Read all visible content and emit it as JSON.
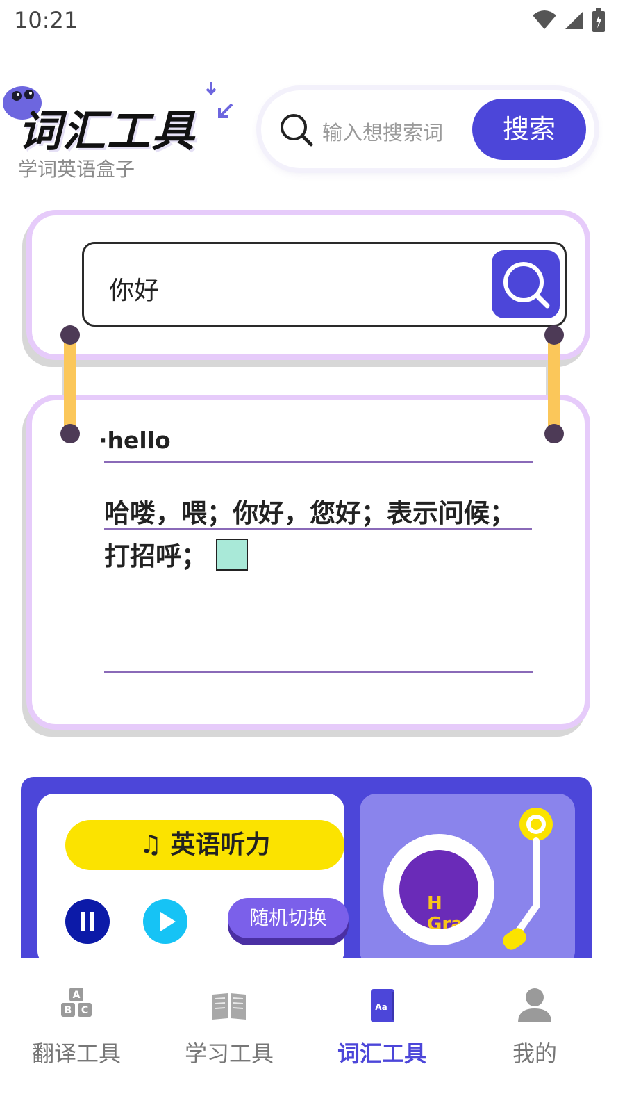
{
  "status_bar": {
    "time": "10:21"
  },
  "header": {
    "logo_title": "词汇工具",
    "logo_subtitle": "学词英语盒子",
    "search": {
      "placeholder": "输入想搜索词",
      "button_label": "搜索"
    }
  },
  "lookup": {
    "input_value": "你好",
    "result_word": "·hello",
    "result_meaning": "哈喽，喂；你好，您好；表示问候；打招呼；"
  },
  "listening": {
    "title": "英语听力",
    "random_label": "随机切换",
    "cover_text": "H Gra"
  },
  "bottom_nav": {
    "items": [
      {
        "label": "翻译工具",
        "icon": "abc-blocks-icon"
      },
      {
        "label": "学习工具",
        "icon": "open-book-icon"
      },
      {
        "label": "词汇工具",
        "icon": "dictionary-icon"
      },
      {
        "label": "我的",
        "icon": "person-icon"
      }
    ],
    "active_index": 2
  },
  "colors": {
    "accent": "#4c46d9",
    "card_border": "#e6cbfa",
    "yellow": "#fbe300",
    "rod": "#fbc75a",
    "play": "#16c3f5",
    "pause": "#0c1aa8"
  }
}
